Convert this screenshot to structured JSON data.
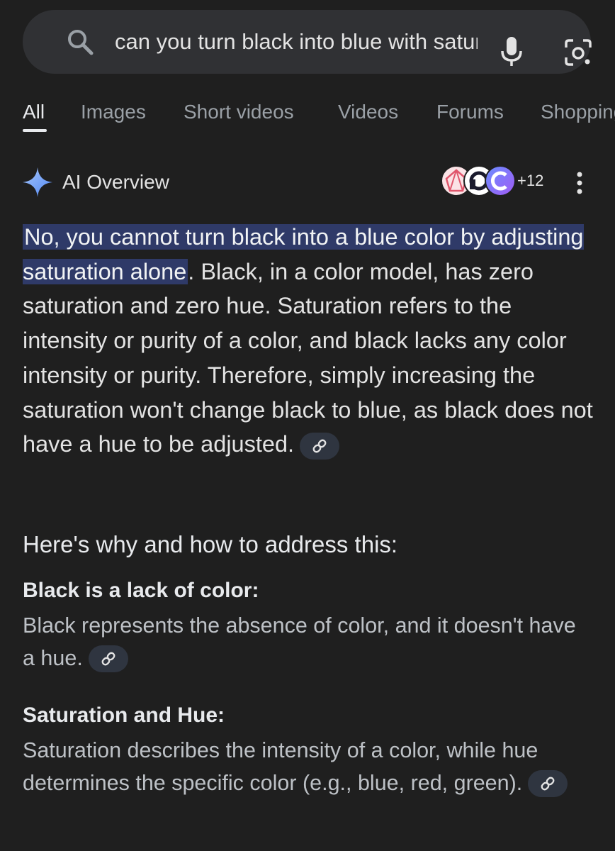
{
  "search": {
    "query": "can you turn black into blue with saturation",
    "icons": [
      "search-icon",
      "microphone-icon",
      "lens-camera-icon"
    ]
  },
  "tabs": [
    {
      "label": "All",
      "active": true
    },
    {
      "label": "Images",
      "active": false
    },
    {
      "label": "Short videos",
      "active": false
    },
    {
      "label": "Videos",
      "active": false
    },
    {
      "label": "Forums",
      "active": false
    },
    {
      "label": "Shopping",
      "active": false
    }
  ],
  "ai_overview": {
    "title": "AI Overview",
    "sources_more": "+12",
    "icons": [
      "sparkle-icon",
      "source-favicon",
      "more-options-icon",
      "link-icon"
    ],
    "highlight_color": "#2f3a68",
    "summary_highlight": "No, you cannot turn black into a blue color by adjusting saturation alone",
    "summary_rest": ". Black, in a color model, has zero saturation and zero hue. Saturation refers to the intensity or purity of a color, and black lacks any color intensity or purity. Therefore, simply increasing the saturation won't change black to blue, as black does not have a hue to be adjusted.",
    "why_heading": "Here's why and how to address this:",
    "sections": [
      {
        "title": "Black is a lack of color:",
        "text": "Black represents the absence of color, and it doesn't have a hue."
      },
      {
        "title": "Saturation and Hue:",
        "text": "Saturation describes the intensity of a color, while hue determines the specific color (e.g., blue, red, green)."
      }
    ]
  },
  "colors": {
    "background": "#1f1f1f",
    "search_bar": "#303134",
    "text_primary": "#e3e3e3",
    "text_secondary": "#bdc1c6",
    "tab_inactive": "#9aa0a6"
  }
}
